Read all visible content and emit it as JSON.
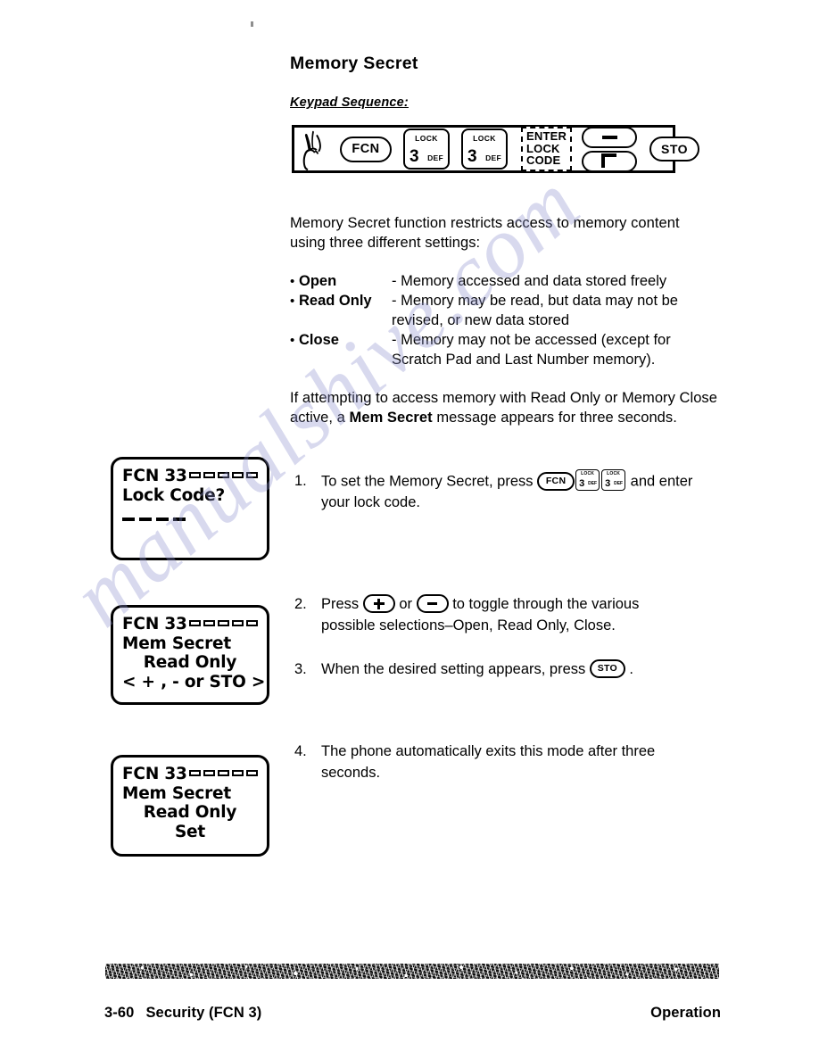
{
  "page": {
    "section_title": "Memory Secret",
    "keypad_sequence_label": "Keypad Sequence:",
    "watermark": "manualshive.com"
  },
  "keypad_sequence": {
    "hand_icon": "pointing-hand-icon",
    "keys": [
      {
        "type": "oval",
        "label": "FCN"
      },
      {
        "type": "square",
        "top": "LOCK",
        "main": "3",
        "sub": "DEF"
      },
      {
        "type": "square",
        "top": "LOCK",
        "main": "3",
        "sub": "DEF"
      },
      {
        "type": "dashed",
        "lines": [
          "ENTER",
          "LOCK",
          "CODE"
        ]
      },
      {
        "type": "minus",
        "label": "−"
      },
      {
        "type": "plus",
        "label": "+"
      },
      {
        "type": "oval",
        "label": "STO"
      }
    ],
    "enter_lock_code": {
      "line1": "ENTER",
      "line2": "LOCK",
      "line3": "CODE"
    },
    "fcn_label": "FCN",
    "sto_label": "STO",
    "lock_key": {
      "top": "LOCK",
      "main": "3",
      "sub": "DEF"
    }
  },
  "intro": {
    "line1": "Memory Secret function restricts access to memory content",
    "line2": "using three different settings:"
  },
  "settings": [
    {
      "bullet": "•",
      "term": "Open",
      "desc": "- Memory accessed and data stored freely",
      "cont": ""
    },
    {
      "bullet": "•",
      "term": "Read Only",
      "desc": "- Memory may be read, but data may not be",
      "cont": "revised, or new data  stored"
    },
    {
      "bullet": "•",
      "term": "Close",
      "desc": "- Memory may not be accessed (except for",
      "cont": "Scratch Pad and Last Number memory)."
    }
  ],
  "note": {
    "part1": "If attempting to access memory with Read Only or Memory Close active, a ",
    "bold": "Mem Secret",
    "part2": " message appears for three seconds."
  },
  "displays": [
    {
      "name": "lock-code-prompt",
      "line1_prefix": "FCN 33",
      "bar_count": 5,
      "line2": "Lock Code?",
      "dash_count": 4
    },
    {
      "name": "mem-secret-select",
      "line1_prefix": "FCN 33",
      "bar_count": 5,
      "line2": "Mem Secret",
      "line3": "Read Only",
      "line4": "< + , - or STO >"
    },
    {
      "name": "mem-secret-set",
      "line1_prefix": "FCN 33",
      "bar_count": 5,
      "line2": "Mem Secret",
      "line3": "Read Only",
      "line4": "Set"
    }
  ],
  "steps": [
    {
      "num": "1.",
      "t1": "To set the Memory Secret, press ",
      "t2": " and enter your lock code.",
      "keys": [
        "FCN",
        "3",
        "3"
      ]
    },
    {
      "num": "2.",
      "t1": "Press ",
      "t2": " or ",
      "t3": " to toggle through the various possible selections–Open, Read Only, Close."
    },
    {
      "num": "3.",
      "t1": "When the desired setting appears, press ",
      "t2": " .",
      "key": "STO"
    },
    {
      "num": "4.",
      "t1": "The phone automatically exits this mode after three seconds."
    }
  ],
  "footer": {
    "page_number": "3-60",
    "section": "Security (FCN 3)",
    "right": "Operation"
  }
}
